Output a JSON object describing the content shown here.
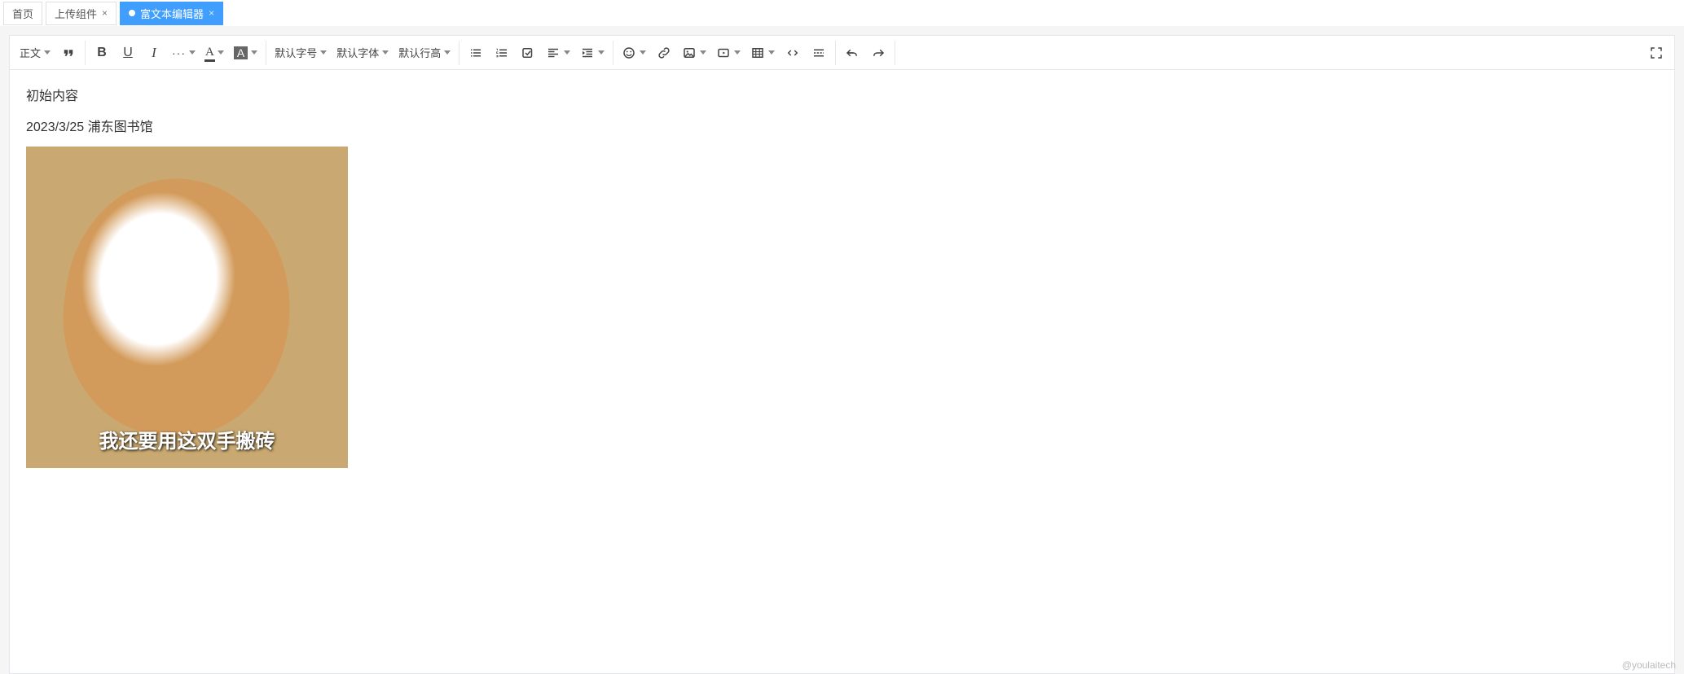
{
  "tabs": [
    {
      "label": "首页",
      "closable": false,
      "active": false
    },
    {
      "label": "上传组件",
      "closable": true,
      "active": false
    },
    {
      "label": "富文本编辑器",
      "closable": true,
      "active": true
    }
  ],
  "toolbar": {
    "paragraph_label": "正文",
    "fontsize_label": "默认字号",
    "fontfamily_label": "默认字体",
    "lineheight_label": "默认行高"
  },
  "content": {
    "line1": "初始内容",
    "line2": "2023/3/25  浦东图书馆",
    "image_caption": "我还要用这双手搬砖"
  },
  "watermark": "@youlaitech"
}
